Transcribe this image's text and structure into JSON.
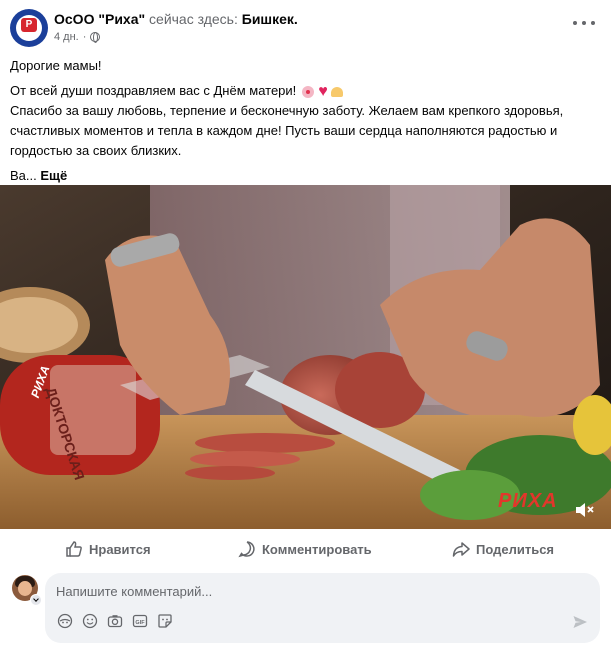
{
  "post": {
    "author": "ОсОО \"Риха\"",
    "here_text": "сейчас здесь:",
    "location": "Бишкек.",
    "time": "4 дн.",
    "avatar_logo": "РИХА",
    "greeting": "Дорогие мамы!",
    "line1": "От всей души поздравляем вас с Днём матери!",
    "line2": "Спасибо за вашу любовь, терпение и бесконечную заботу. Желаем вам крепкого здоровья, счастливых моментов и тепла в каждом дне! Пусть ваши сердца наполняются радостью и гордостью за своих близких.",
    "truncated": "Ва...",
    "see_more": "Ещё",
    "emojis": [
      "flower-emoji",
      "red-heart-emoji",
      "heart-hands-emoji"
    ]
  },
  "media": {
    "description_icon": "video",
    "watermark": "РИХА",
    "sausage_label": "ДОКТОРСКАЯ",
    "sausage_brand": "РИХА",
    "mute_icon": "speaker-muted-icon"
  },
  "actions": {
    "like": "Нравится",
    "comment": "Комментировать",
    "share": "Поделиться"
  },
  "comment_composer": {
    "placeholder": "Напишите комментарий...",
    "tools": [
      "avatar-sticker-icon",
      "emoji-icon",
      "camera-icon",
      "gif-icon",
      "sticker-icon"
    ],
    "send_icon": "send-icon"
  },
  "colors": {
    "brand_blue": "#1b3f9a",
    "brand_red": "#d7262e",
    "secondary_text": "#65676b",
    "composer_bg": "#f0f2f5"
  }
}
